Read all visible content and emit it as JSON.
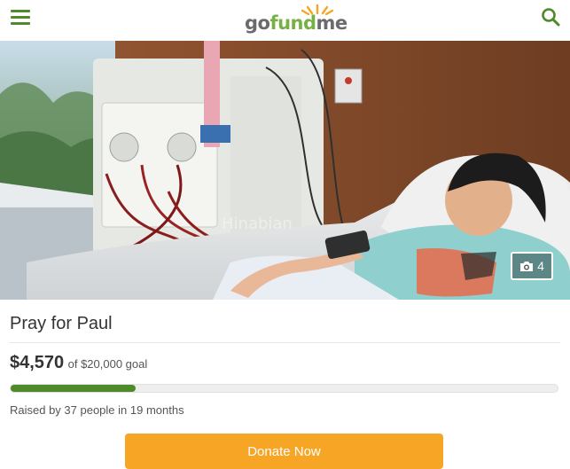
{
  "header": {
    "menu_icon": "hamburger-menu-icon",
    "logo": {
      "go": "go",
      "fund": "fund",
      "me": "me",
      "brand_green": "#77b145"
    },
    "search_icon": "search-icon"
  },
  "hero": {
    "photo_count": "4",
    "camera_icon": "camera-icon"
  },
  "campaign": {
    "title": "Pray for Paul",
    "amount_raised": "$4,570",
    "goal_text": "of $20,000 goal",
    "progress_fraction": 0.2285,
    "raised_by": "Raised by 37 people in 19 months"
  },
  "actions": {
    "donate_label": "Donate Now"
  },
  "colors": {
    "accent_green": "#4f8a2a",
    "donate_orange": "#f6a624"
  }
}
